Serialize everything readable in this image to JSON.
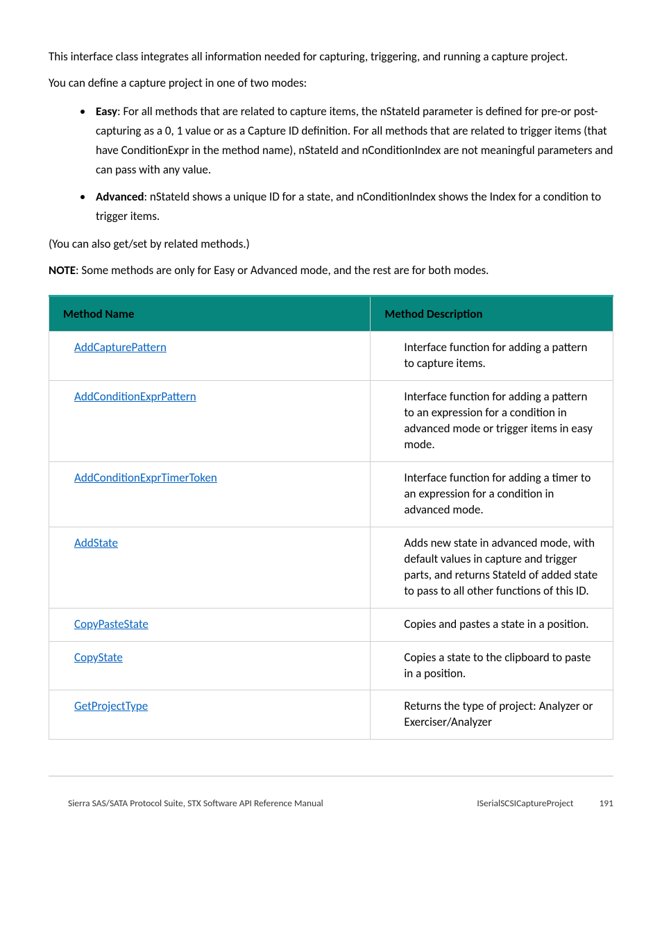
{
  "intro": {
    "p1": "This interface class integrates all information needed for capturing, triggering, and running a capture project.",
    "p2": "You can define a capture project in one of two modes:",
    "bullets": {
      "b1_bold": "Easy",
      "b1_rest": ": For all methods that are related to capture items, the nStateId parameter is defined for pre-or post-capturing as a 0, 1 value or as a Capture ID definition. For all methods that are related to trigger items (that have ConditionExpr in the method name), nStateId and nConditionIndex are not meaningful parameters and can pass with any value.",
      "b2_bold": "Advanced",
      "b2_rest": ": nStateId shows a unique ID for a state, and nConditionIndex shows the Index for a condition to trigger items."
    },
    "p3": "(You can also get/set by related methods.)",
    "note_bold": "NOTE",
    "note_rest": ": Some methods are only for Easy or Advanced mode, and the rest are for both modes."
  },
  "table": {
    "headers": {
      "name": "Method Name",
      "desc": "Method Description"
    },
    "rows": [
      {
        "name": "AddCapturePattern",
        "desc": "Interface function for adding a pattern to capture items."
      },
      {
        "name": "AddConditionExprPattern",
        "desc": "Interface function for adding a pattern to an expression for a condition in advanced mode or trigger items in easy mode."
      },
      {
        "name": "AddConditionExprTimerToken",
        "desc": "Interface function for adding a timer to an expression for a condition in advanced mode."
      },
      {
        "name": "AddState",
        "desc": "Adds new state in advanced mode, with default values in capture and trigger parts, and returns StateId of added state to pass to all other functions of this ID."
      },
      {
        "name": "CopyPasteState",
        "desc": "Copies and pastes a state in a position."
      },
      {
        "name": "CopyState",
        "desc": "Copies a state to the clipboard to paste in a position."
      },
      {
        "name": "GetProjectType",
        "desc": "Returns the type of project: Analyzer or Exerciser/Analyzer"
      }
    ]
  },
  "footer": {
    "left": "Sierra SAS/SATA Protocol Suite, STX Software API Reference Manual",
    "right_api": "ISerialSCSICaptureProject",
    "right_page": "191"
  }
}
